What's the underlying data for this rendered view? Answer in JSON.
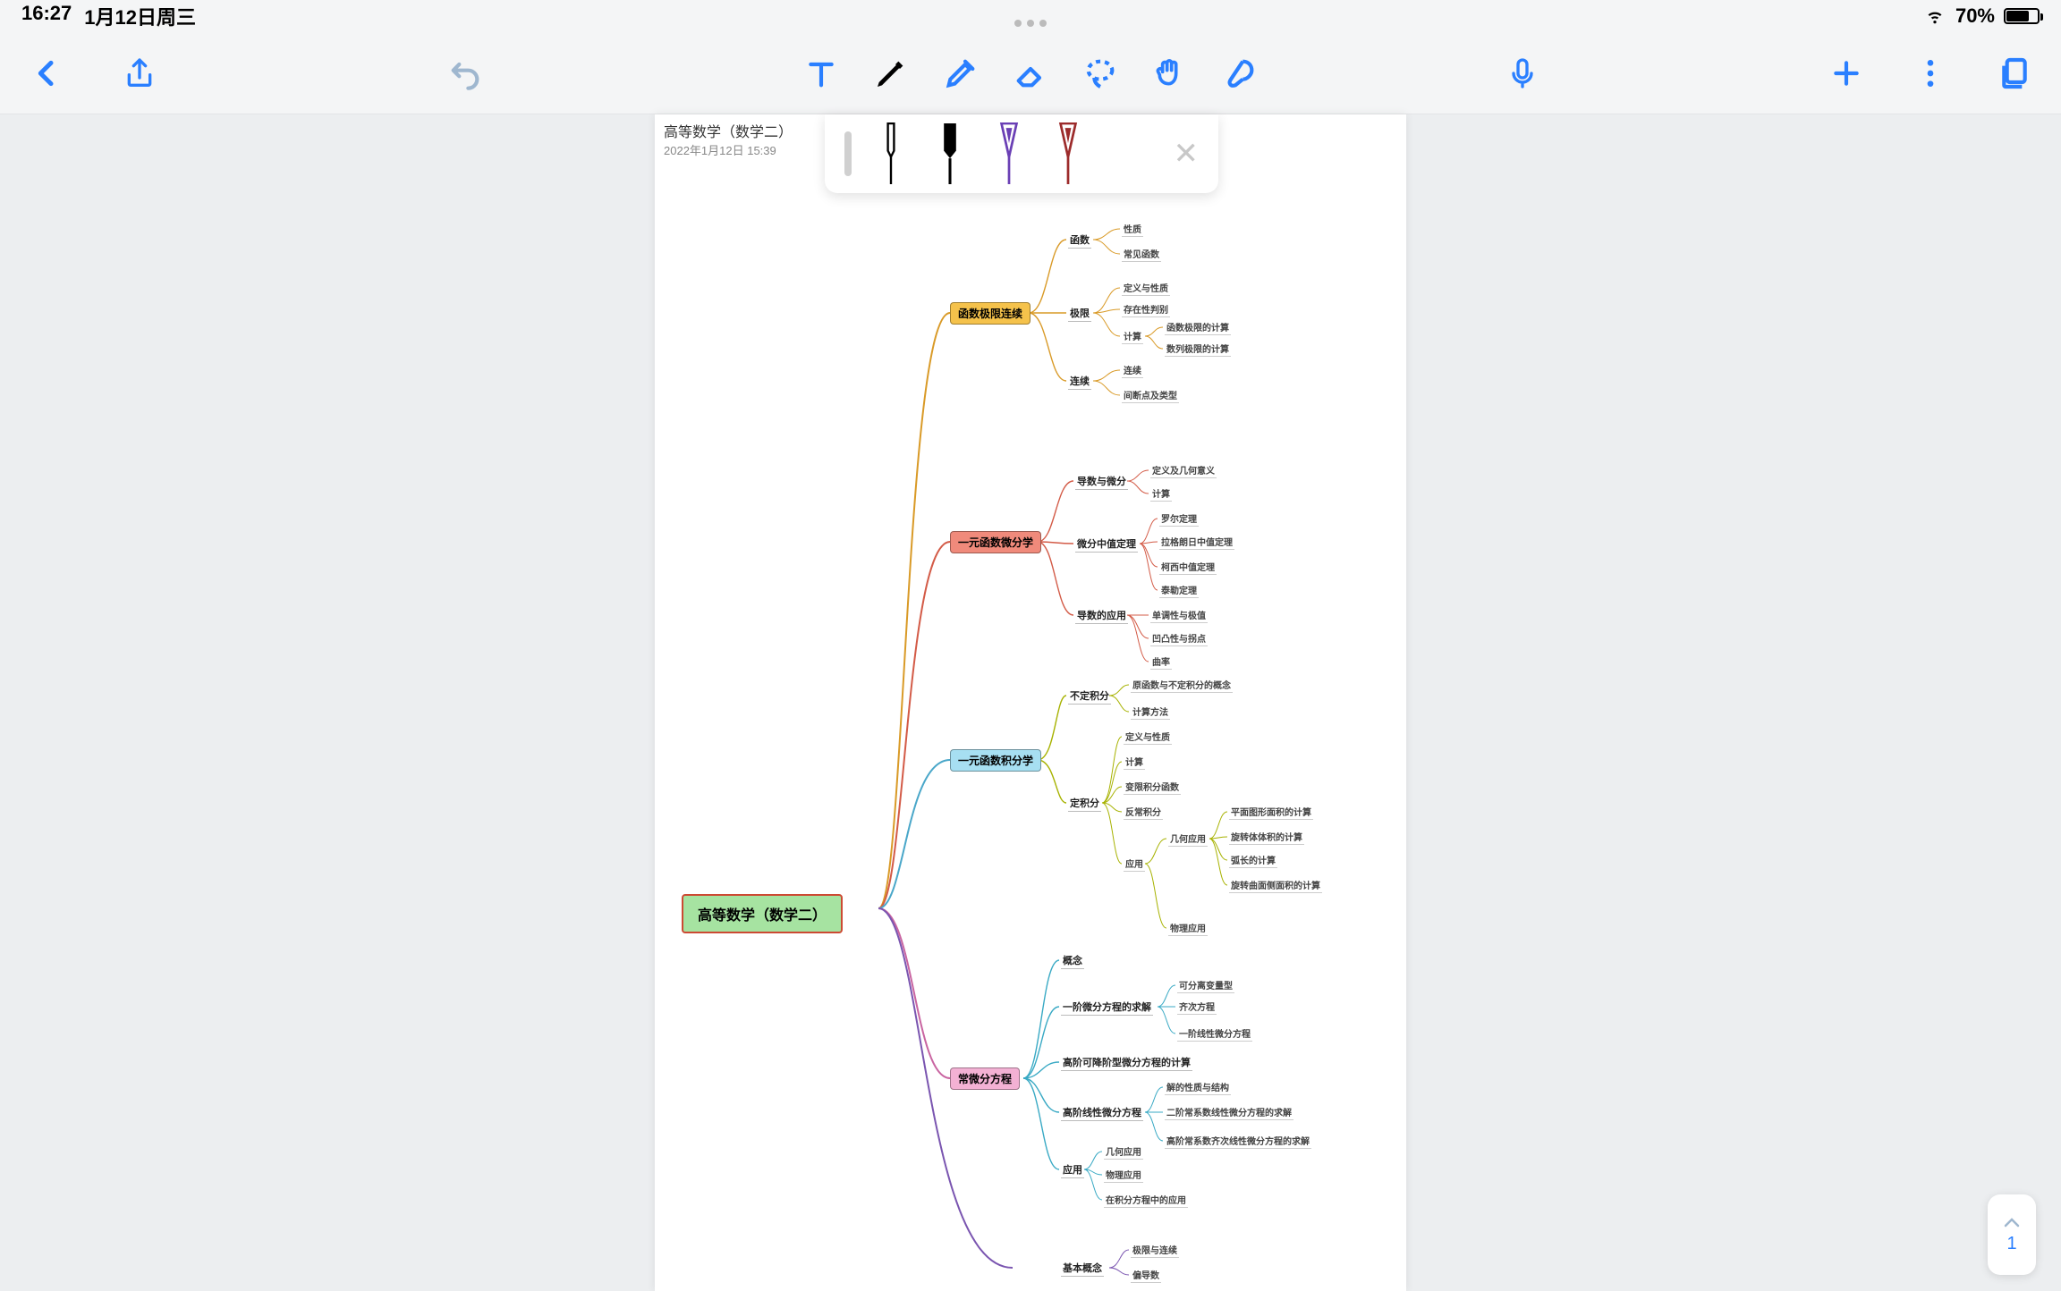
{
  "status": {
    "time": "16:27",
    "date": "1月12日周三",
    "battery_pct": "70%"
  },
  "note": {
    "title": "高等数学（数学二）",
    "created": "2022年1月12日 15:39"
  },
  "nav": {
    "page": "1"
  },
  "colors": {
    "root": "#a6e3a1",
    "c1": "#f5c24b",
    "c2": "#f08a7b",
    "c3": "#a7dff2",
    "c4": "#f3b1d4",
    "blue": "#2a7fff"
  },
  "mindmap": {
    "root": "高等数学（数学二）",
    "branches": [
      {
        "id": "b1",
        "label": "函数极限连续",
        "color": "c1",
        "children": [
          {
            "label": "函数",
            "leaves": [
              "性质",
              "常见函数"
            ]
          },
          {
            "label": "极限",
            "leaves": [
              "定义与性质",
              "存在性判别",
              "计算"
            ],
            "subleaves_of_2": [
              "函数极限的计算",
              "数列极限的计算"
            ]
          },
          {
            "label": "连续",
            "leaves": [
              "连续",
              "间断点及类型"
            ]
          }
        ]
      },
      {
        "id": "b2",
        "label": "一元函数微分学",
        "color": "c2",
        "children": [
          {
            "label": "导数与微分",
            "leaves": [
              "定义及几何意义",
              "计算"
            ]
          },
          {
            "label": "微分中值定理",
            "leaves": [
              "罗尔定理",
              "拉格朗日中值定理",
              "柯西中值定理",
              "泰勒定理"
            ]
          },
          {
            "label": "导数的应用",
            "leaves": [
              "单调性与极值",
              "凹凸性与拐点",
              "曲率"
            ]
          }
        ]
      },
      {
        "id": "b3",
        "label": "一元函数积分学",
        "color": "c3",
        "children": [
          {
            "label": "不定积分",
            "leaves": [
              "原函数与不定积分的概念",
              "计算方法"
            ]
          },
          {
            "label": "定积分",
            "leaves": [
              "定义与性质",
              "计算",
              "变限积分函数",
              "反常积分",
              "应用"
            ],
            "app_children": [
              {
                "label": "几何应用",
                "leaves": [
                  "平面图形面积的计算",
                  "旋转体体积的计算",
                  "弧长的计算",
                  "旋转曲面侧面积的计算"
                ]
              },
              {
                "label": "物理应用",
                "leaves": []
              }
            ]
          }
        ]
      },
      {
        "id": "b4",
        "label": "常微分方程",
        "color": "c4",
        "children": [
          {
            "label": "概念",
            "leaves": []
          },
          {
            "label": "一阶微分方程的求解",
            "leaves": [
              "可分离变量型",
              "齐次方程",
              "一阶线性微分方程"
            ]
          },
          {
            "label": "高阶可降阶型微分方程的计算",
            "leaves": []
          },
          {
            "label": "高阶线性微分方程",
            "leaves": [
              "解的性质与结构",
              "二阶常系数线性微分方程的求解",
              "高阶常系数齐次线性微分方程的求解"
            ]
          },
          {
            "label": "应用",
            "leaves": [
              "几何应用",
              "物理应用",
              "在积分方程中的应用"
            ]
          }
        ]
      },
      {
        "id": "b5_partial",
        "label": "基本概念",
        "color": "",
        "children": [
          {
            "label": "",
            "leaves": [
              "极限与连续",
              "偏导数"
            ]
          }
        ]
      }
    ]
  }
}
